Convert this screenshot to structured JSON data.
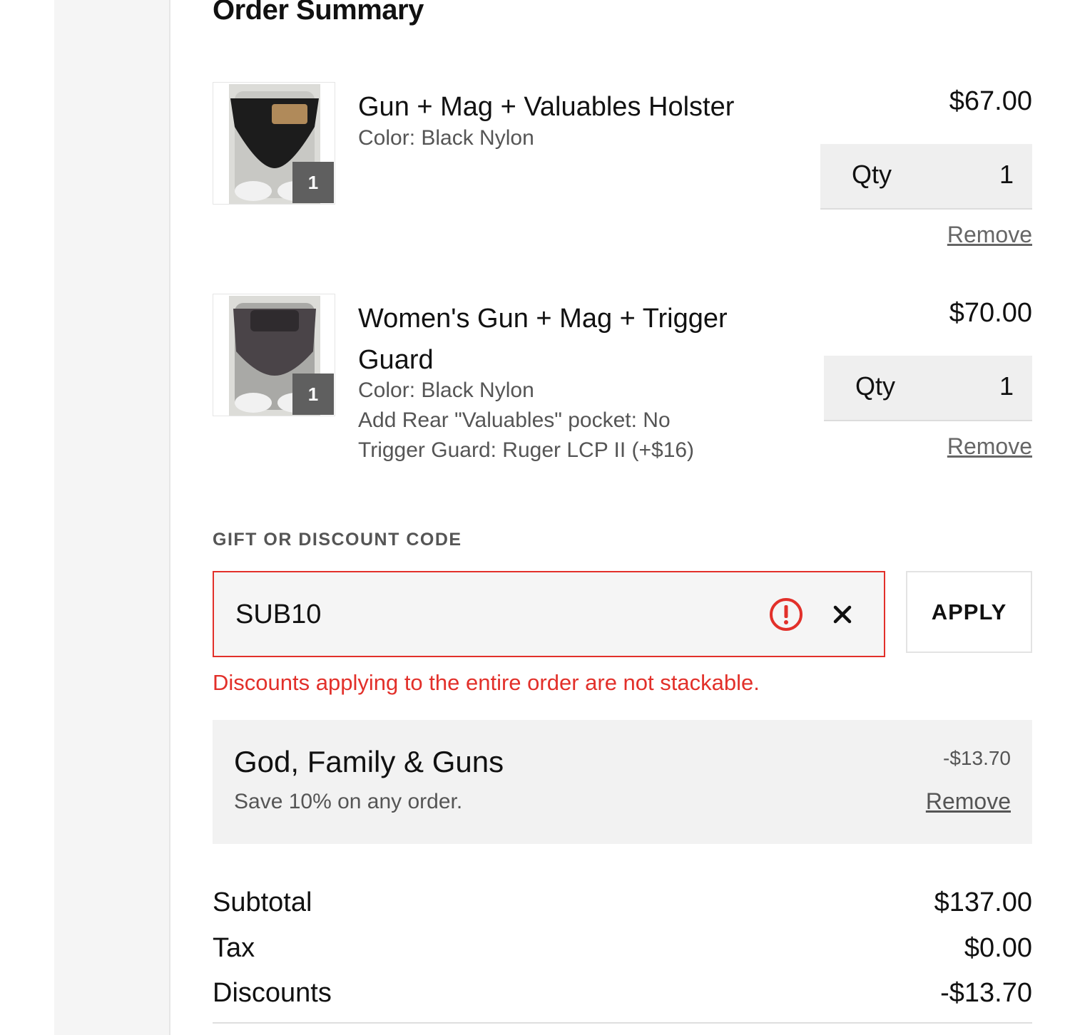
{
  "summary": {
    "title": "Order Summary",
    "items": [
      {
        "name": "Gun + Mag + Valuables Holster",
        "options": [
          "Color: Black Nylon"
        ],
        "price": "$67.00",
        "qty_label": "Qty",
        "qty": "1",
        "badge": "1",
        "remove_label": "Remove"
      },
      {
        "name": "Women's Gun + Mag + Trigger Guard",
        "options": [
          "Color: Black Nylon",
          "Add Rear \"Valuables\" pocket: No",
          "Trigger Guard: Ruger LCP II (+$16)"
        ],
        "price": "$70.00",
        "qty_label": "Qty",
        "qty": "1",
        "badge": "1",
        "remove_label": "Remove"
      }
    ],
    "discount_code": {
      "label": "GIFT OR DISCOUNT CODE",
      "value": "SUB10",
      "apply_label": "APPLY",
      "error": "Discounts applying to the entire order are not stackable."
    },
    "applied_discount": {
      "name": "God, Family & Guns",
      "description": "Save 10% on any order.",
      "amount": "-$13.70",
      "remove_label": "Remove"
    },
    "totals": {
      "subtotal_label": "Subtotal",
      "subtotal": "$137.00",
      "tax_label": "Tax",
      "tax": "$0.00",
      "discounts_label": "Discounts",
      "discounts": "-$13.70"
    }
  },
  "colors": {
    "error": "#e2302a",
    "badge": "#5f5f5f",
    "panel": "#f2f2f2"
  },
  "icons": {
    "alert": "exclamation-circle-icon",
    "clear": "close-icon"
  }
}
